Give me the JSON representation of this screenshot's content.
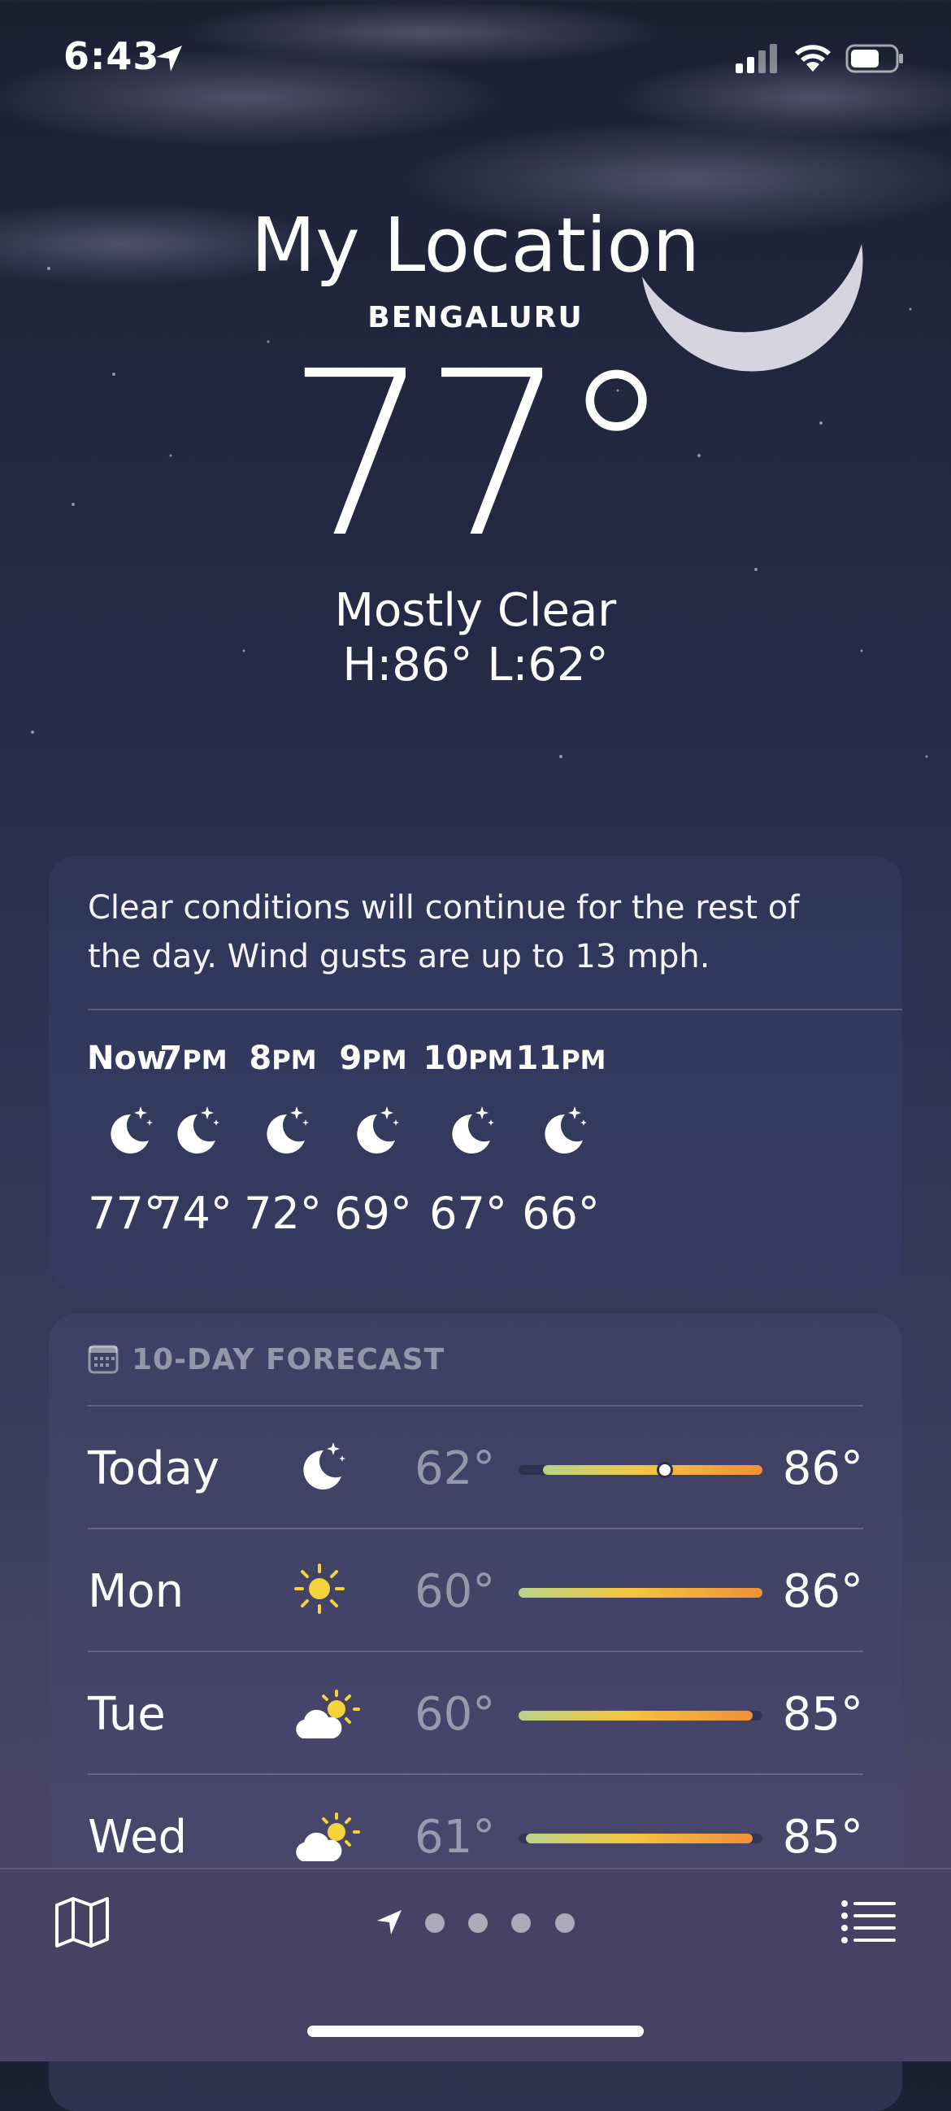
{
  "status_bar": {
    "time": "6:43"
  },
  "location": {
    "title": "My Location",
    "city": "BENGALURU"
  },
  "current": {
    "temp": "77°",
    "condition": "Mostly Clear",
    "high_low": "H:86°  L:62°"
  },
  "hourly": {
    "summary": "Clear conditions will continue for the rest of the day. Wind gusts are up to 13 mph.",
    "items": [
      {
        "label": "Now",
        "suffix": "",
        "icon": "moon-stars-icon",
        "temp": "77°"
      },
      {
        "label": "7",
        "suffix": "PM",
        "icon": "moon-stars-icon",
        "temp": "74°"
      },
      {
        "label": "8",
        "suffix": "PM",
        "icon": "moon-stars-icon",
        "temp": "72°"
      },
      {
        "label": "9",
        "suffix": "PM",
        "icon": "moon-stars-icon",
        "temp": "69°"
      },
      {
        "label": "10",
        "suffix": "PM",
        "icon": "moon-stars-icon",
        "temp": "67°"
      },
      {
        "label": "11",
        "suffix": "PM",
        "icon": "moon-stars-icon",
        "temp": "66°"
      }
    ]
  },
  "forecast": {
    "header": "10-DAY FORECAST",
    "rows": [
      {
        "day": "Today",
        "icon": "moon-stars-icon",
        "low": "62°",
        "high": "86°",
        "range_start": 0.1,
        "range_end": 1.0,
        "current_pos": 0.6
      },
      {
        "day": "Mon",
        "icon": "sun-icon",
        "low": "60°",
        "high": "86°",
        "range_start": 0.0,
        "range_end": 1.0
      },
      {
        "day": "Tue",
        "icon": "cloud-sun-icon",
        "low": "60°",
        "high": "85°",
        "range_start": 0.0,
        "range_end": 0.96
      },
      {
        "day": "Wed",
        "icon": "cloud-sun-icon",
        "low": "61°",
        "high": "85°",
        "range_start": 0.03,
        "range_end": 0.96
      }
    ]
  },
  "tab_bar": {
    "page_count": 4,
    "icons": [
      "map-icon",
      "location-arrow-icon",
      "list-icon"
    ]
  }
}
